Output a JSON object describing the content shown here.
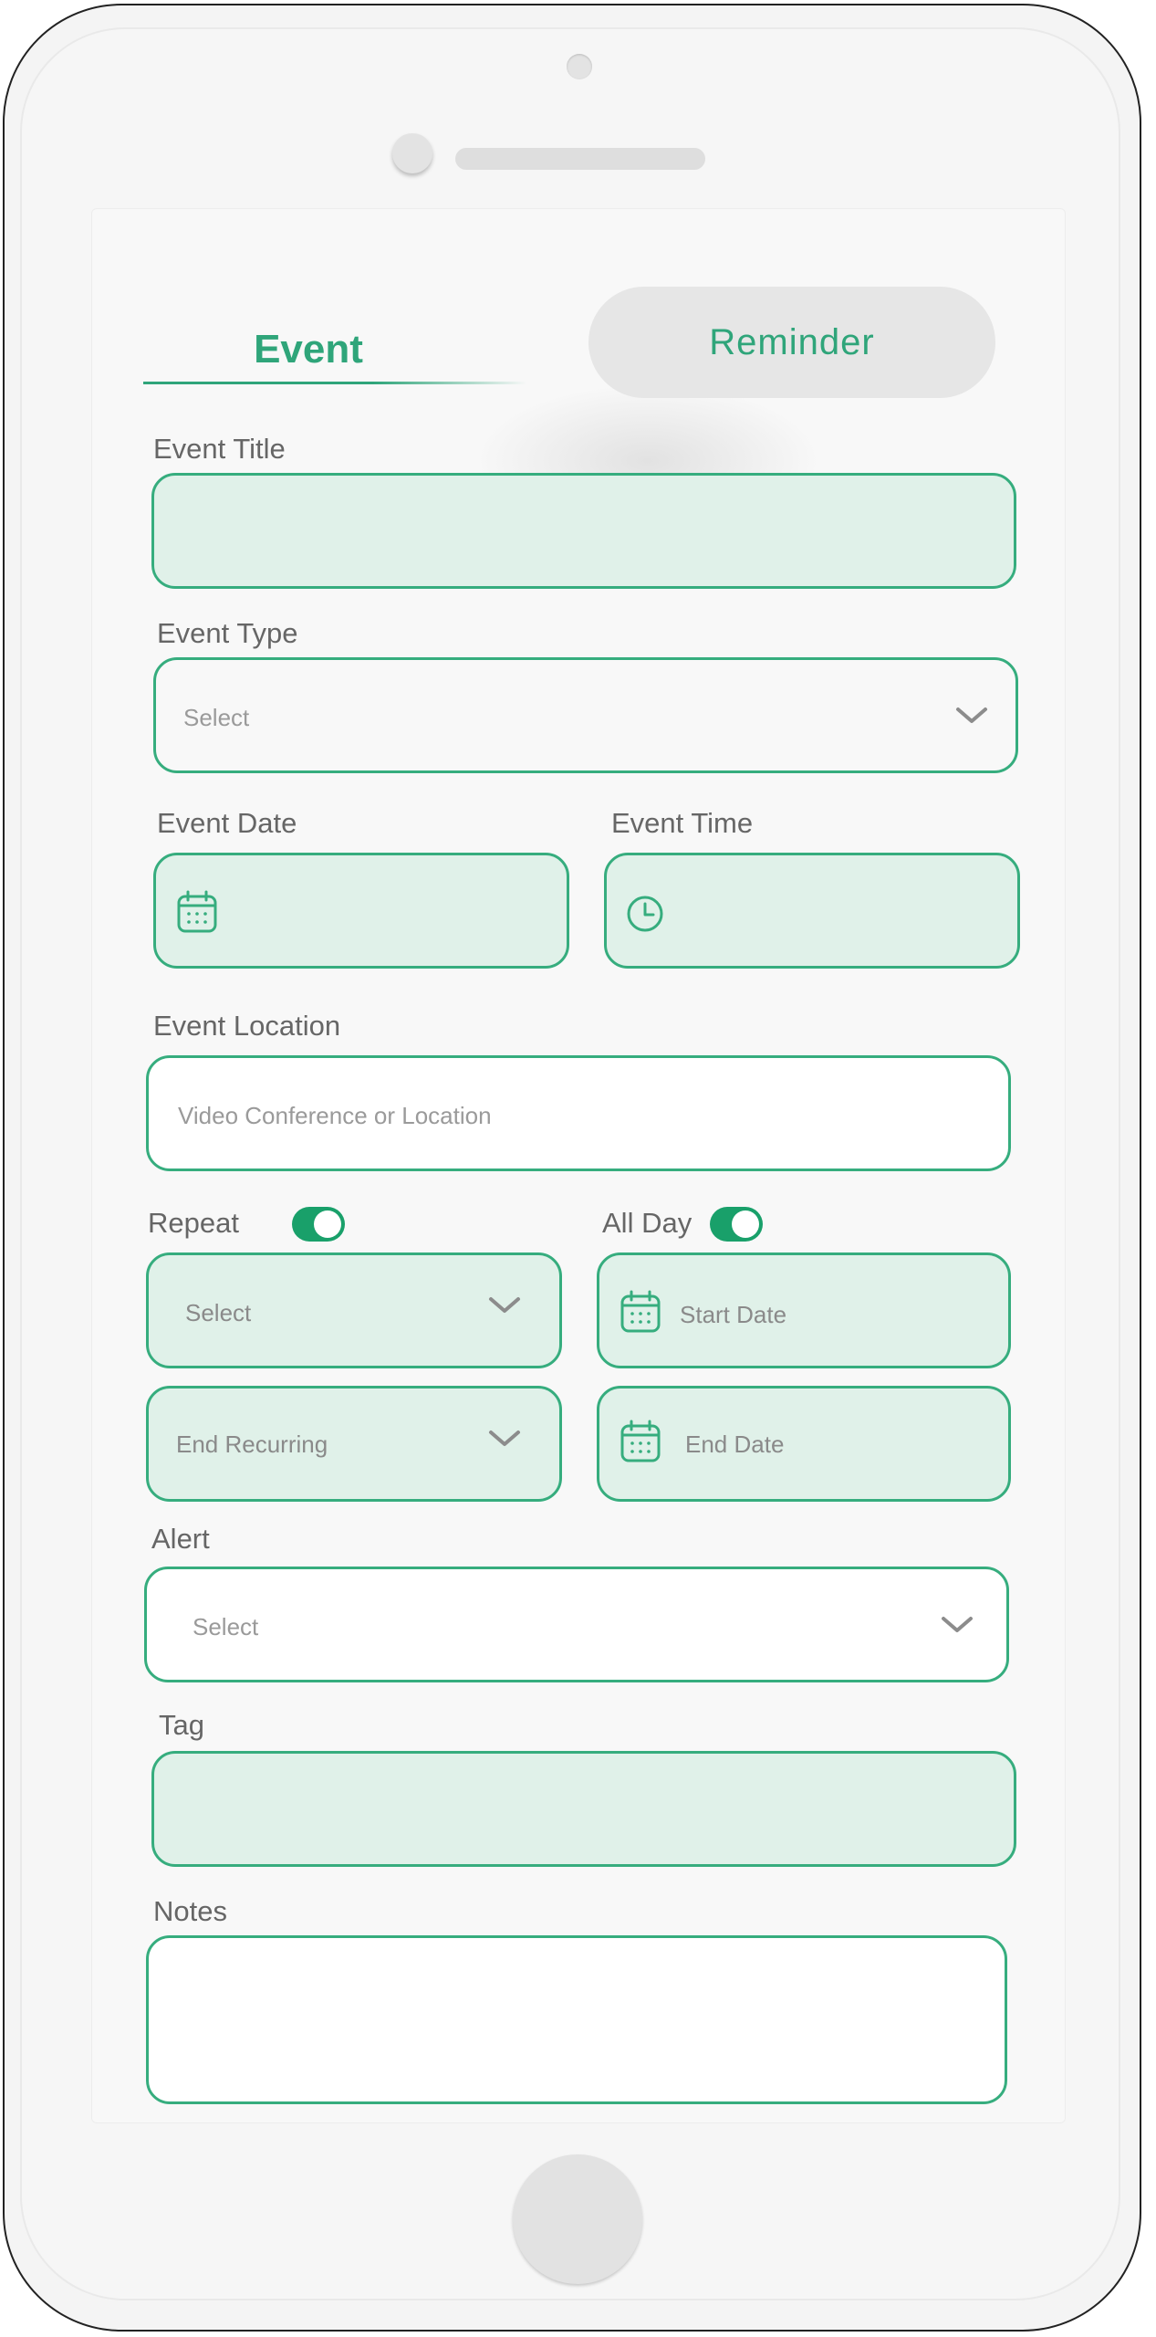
{
  "tabs": {
    "event": "Event",
    "reminder": "Reminder"
  },
  "form": {
    "event_title": {
      "label": "Event Title",
      "value": ""
    },
    "event_type": {
      "label": "Event Type",
      "placeholder": "Select"
    },
    "event_date": {
      "label": "Event Date",
      "value": ""
    },
    "event_time": {
      "label": "Event Time",
      "value": ""
    },
    "event_location": {
      "label": "Event Location",
      "placeholder": "Video Conference or Location"
    },
    "repeat": {
      "label": "Repeat",
      "toggle_on": true,
      "select_placeholder": "Select",
      "end_recurring_placeholder": "End Recurring"
    },
    "all_day": {
      "label": "All Day",
      "toggle_on": true,
      "start_placeholder": "Start Date",
      "end_placeholder": "End Date"
    },
    "alert": {
      "label": "Alert",
      "placeholder": "Select"
    },
    "tag": {
      "label": "Tag",
      "value": ""
    },
    "notes": {
      "label": "Notes",
      "value": ""
    }
  },
  "colors": {
    "accent": "#2fa57a",
    "field_border": "#36ad7e",
    "field_tint": "#e0f1e9",
    "toggle": "#19a06a"
  },
  "icons": [
    "calendar-icon",
    "clock-icon",
    "chevron-down-icon"
  ]
}
